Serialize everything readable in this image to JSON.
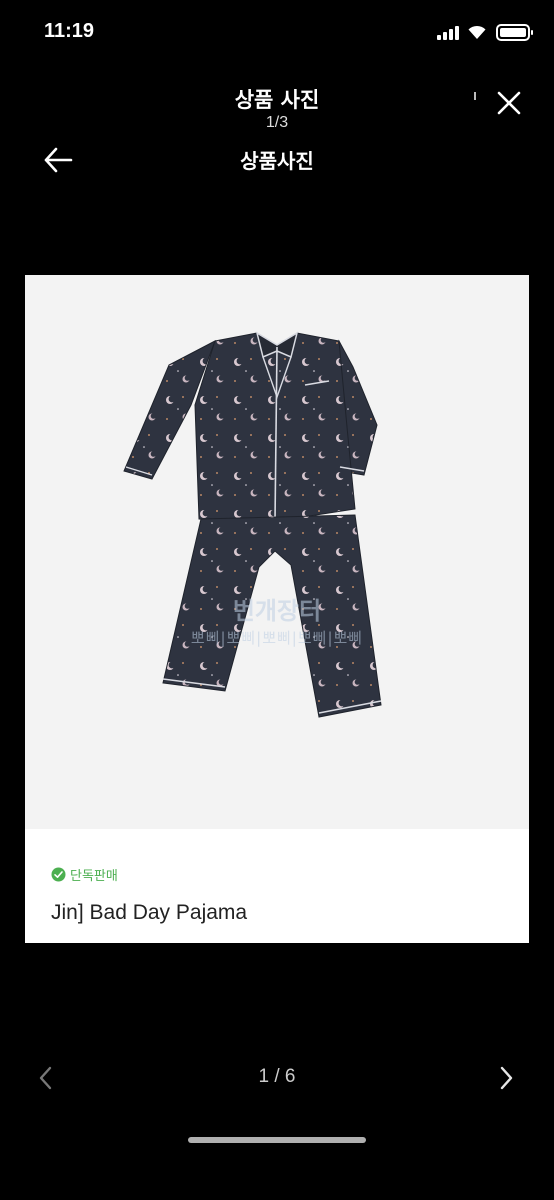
{
  "status_bar": {
    "time": "11:19"
  },
  "viewer": {
    "title": "상품 사진",
    "counter": "1/3"
  },
  "page": {
    "title": "상품사진"
  },
  "product": {
    "badge": "단독판매",
    "name": "Jin] Bad Day Pajama",
    "watermark": "번개장터",
    "watermark_sub": "뽀삐|뽀삐|뽀삐|뽀삐|뽀삐"
  },
  "pager": {
    "text": "1 / 6"
  },
  "colors": {
    "background": "#000000",
    "card": "#ffffff",
    "badge_green": "#4caf50",
    "pajama_navy": "#2e3340"
  },
  "icons": {
    "close": "close-icon",
    "back": "arrow-left-icon",
    "prev": "chevron-left-icon",
    "next": "chevron-right-icon",
    "badge": "check-circle-icon"
  }
}
